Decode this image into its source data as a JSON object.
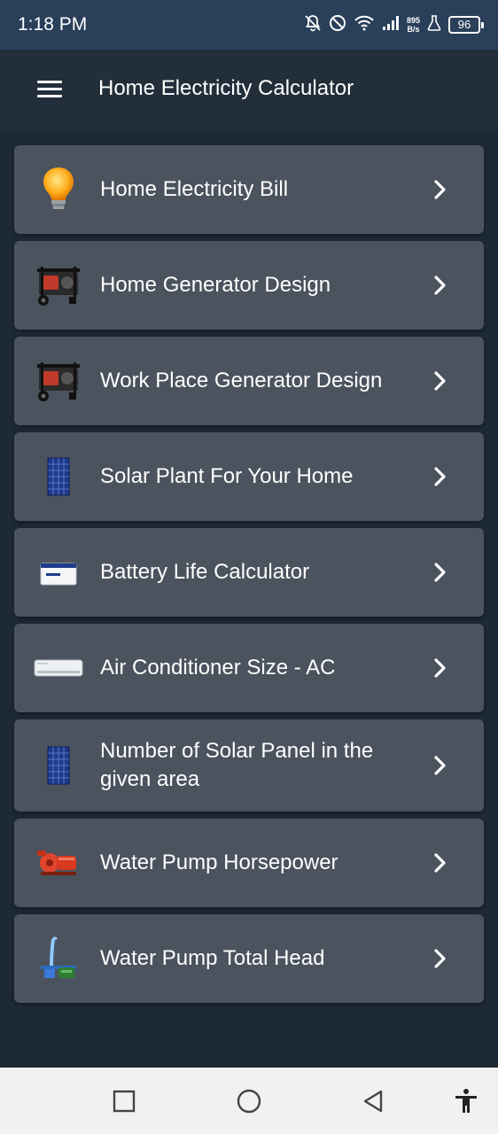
{
  "status_bar": {
    "time": "1:18 PM",
    "net_speed_value": "895",
    "net_speed_unit": "B/s",
    "battery": "96",
    "icons": [
      "notifications-off-icon",
      "do-not-disturb-icon",
      "wifi-icon",
      "signal-icon",
      "lab-icon",
      "battery-icon"
    ]
  },
  "app_bar": {
    "title": "Home Electricity Calculator",
    "menu_icon": "hamburger-menu-icon"
  },
  "menu": {
    "items": [
      {
        "label": "Home Electricity Bill",
        "icon": "light-bulb-icon"
      },
      {
        "label": "Home Generator Design",
        "icon": "generator-icon"
      },
      {
        "label": "Work Place Generator Design",
        "icon": "generator-icon"
      },
      {
        "label": "Solar Plant For Your Home",
        "icon": "solar-panel-icon"
      },
      {
        "label": "Battery Life Calculator",
        "icon": "battery-icon"
      },
      {
        "label": "Air Conditioner Size - AC",
        "icon": "air-conditioner-icon"
      },
      {
        "label": "Number of Solar Panel in the given area",
        "icon": "solar-panel-icon"
      },
      {
        "label": "Water Pump Horsepower",
        "icon": "water-pump-icon"
      },
      {
        "label": "Water Pump Total Head",
        "icon": "pump-head-icon"
      }
    ]
  },
  "nav_bar": {
    "buttons": [
      "recents-button",
      "home-button",
      "back-button",
      "accessibility-button"
    ]
  }
}
